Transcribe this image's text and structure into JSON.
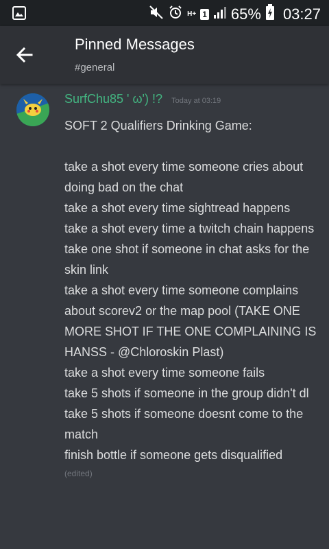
{
  "status_bar": {
    "battery_percent": "65%",
    "time": "03:27",
    "sim_slot": "1",
    "network_type": "H+",
    "icons": [
      "screenshot-icon",
      "mute-icon",
      "alarm-icon",
      "signal-icon",
      "battery-charging-icon"
    ]
  },
  "header": {
    "title": "Pinned Messages",
    "subtitle": "#general"
  },
  "message": {
    "username": "SurfChu85 ' ω') !?",
    "timestamp": "Today at 03:19",
    "lines": [
      "SOFT 2 Qualifiers Drinking Game:",
      "",
      "take a shot every time someone cries about doing bad on the chat",
      "take a shot every time sightread happens",
      "take a shot every time a twitch chain happens",
      "take one shot if someone in chat asks for the skin link",
      "take a shot every time someone complains about scorev2 or the map pool (TAKE ONE MORE SHOT IF THE ONE COMPLAINING IS HANSS - @Chloroskin Plast)",
      "take a shot every time someone fails",
      "take 5 shots if someone in the group didn't dl",
      "take 5 shots if someone doesnt come to the match",
      "finish bottle if someone gets disqualified"
    ],
    "edited_label": "(edited)"
  },
  "colors": {
    "background": "#36393f",
    "appbar": "#2f3136",
    "statusbar": "#1e2124",
    "username": "#43b581",
    "text": "#dcddde",
    "muted": "#72767d"
  }
}
